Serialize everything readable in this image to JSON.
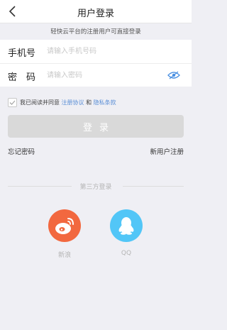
{
  "nav": {
    "title": "用户登录",
    "back_icon": "chevron-left-icon"
  },
  "notice": "轻快云平台的注册用户可直接登录",
  "form": {
    "phone": {
      "label": "手机号",
      "placeholder": "请输入手机号码",
      "value": ""
    },
    "password": {
      "label": "密　码",
      "placeholder": "请输入密码",
      "value": "",
      "toggle_icon": "eye-icon"
    }
  },
  "agreement": {
    "checked": true,
    "prefix": "我已阅读并同意",
    "terms_link": "注册协议",
    "and": "和",
    "privacy_link": "隐私条款"
  },
  "login_button": "登录",
  "links": {
    "forgot": "忘记密码",
    "register": "新用户注册"
  },
  "third_party": {
    "title": "第三方登录",
    "weibo_label": "新浪",
    "qq_label": "QQ"
  },
  "colors": {
    "background": "#efeff4",
    "link": "#5b8fd6",
    "button_disabled": "#d9d9d9",
    "weibo": "#f2683f",
    "qq": "#52c6f7"
  }
}
